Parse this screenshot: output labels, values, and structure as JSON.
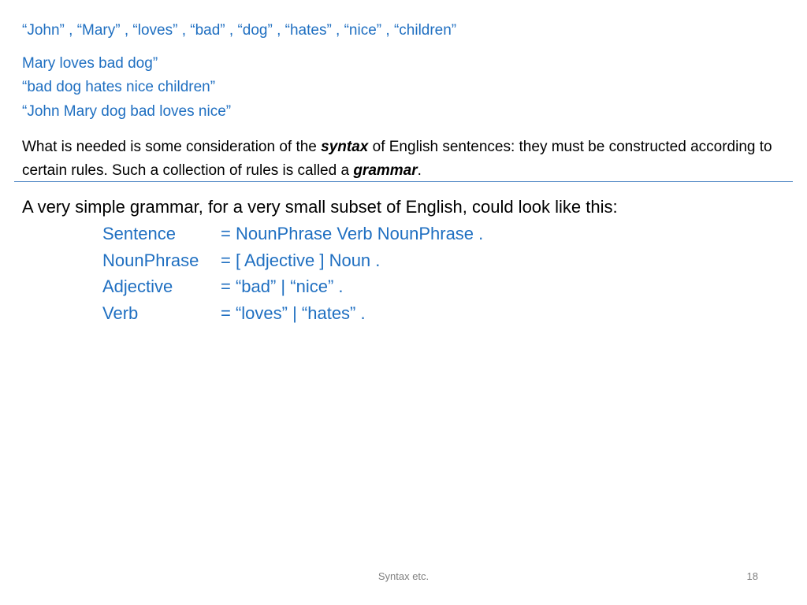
{
  "words_line": "“John” ,  “Mary” , “loves” , “bad” , “dog” , “hates” , “nice” , “children”",
  "examples": [
    "Mary loves bad dog”",
    "“bad dog hates nice children”",
    "“John Mary dog bad loves nice”"
  ],
  "paragraph": {
    "part1": "What is needed is some consideration of the ",
    "syntax_word": "syntax",
    "part2": " of English sentences: they must be constructed according to certain rules.  Such a collection of rules is called a ",
    "grammar_word": "grammar",
    "part3": "."
  },
  "intro": "A very simple grammar, for a very small subset of English, could look like this:",
  "grammar_rules": [
    {
      "lhs": "Sentence",
      "rhs": "=  NounPhrase   Verb   NounPhrase ."
    },
    {
      "lhs": "NounPhrase",
      "rhs": "=  [ Adjective ]  Noun ."
    },
    {
      "lhs": "Adjective",
      "rhs": "=  “bad”  |  “nice” ."
    },
    {
      "lhs": "Verb",
      "rhs": "=  “loves”  |  “hates” ."
    }
  ],
  "footer": {
    "title": "Syntax etc.",
    "page_number": "18"
  },
  "colors": {
    "accent_blue": "#1f6fc1",
    "divider": "#5b8fc9",
    "footer_gray": "#7f7f7f"
  }
}
